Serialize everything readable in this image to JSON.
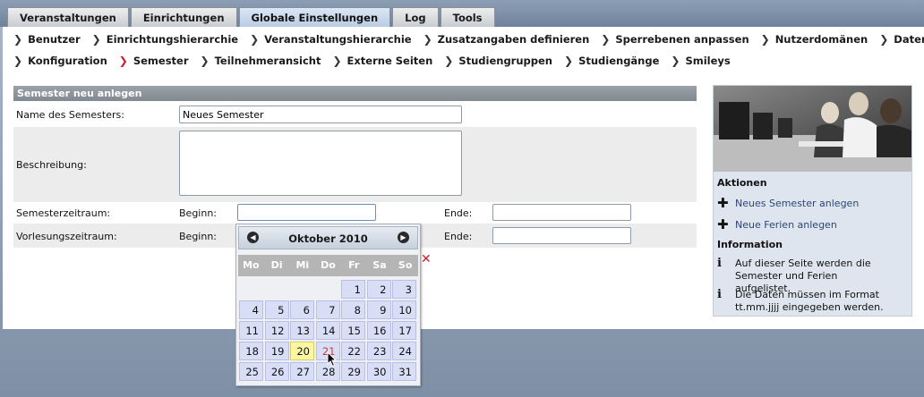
{
  "tabs": [
    "Veranstaltungen",
    "Einrichtungen",
    "Globale Einstellungen",
    "Log",
    "Tools"
  ],
  "active_tab": "Globale Einstellungen",
  "subnav_row1": [
    "Benutzer",
    "Einrichtungshierarchie",
    "Veranstaltungshierarchie",
    "Zusatzangaben definieren",
    "Sperrebenen anpassen",
    "Nutzerdomänen",
    "Datenfelder"
  ],
  "subnav_row2": [
    "Konfiguration",
    "Semester",
    "Teilnehmeransicht",
    "Externe Seiten",
    "Studiengruppen",
    "Studiengänge",
    "Smileys"
  ],
  "active_subnav": "Semester",
  "form": {
    "header": "Semester neu anlegen",
    "name_label": "Name des Semesters:",
    "name_value": "Neues Semester",
    "description_label": "Beschreibung:",
    "description_value": "",
    "semester_period_label": "Semesterzeitraum:",
    "lecture_period_label": "Vorlesungszeitraum:",
    "begin_label": "Beginn:",
    "end_label": "Ende:"
  },
  "calendar": {
    "title": "Oktober 2010",
    "weekdays": [
      "Mo",
      "Di",
      "Mi",
      "Do",
      "Fr",
      "Sa",
      "So"
    ],
    "leading_blanks": 4,
    "days": [
      "1",
      "2",
      "3",
      "4",
      "5",
      "6",
      "7",
      "8",
      "9",
      "10",
      "11",
      "12",
      "13",
      "14",
      "15",
      "16",
      "17",
      "18",
      "19",
      "20",
      "21",
      "22",
      "23",
      "24",
      "25",
      "26",
      "27",
      "28",
      "29",
      "30",
      "31"
    ],
    "today": "20",
    "highlighted_red": "21"
  },
  "sidebar": {
    "actions_title": "Aktionen",
    "actions": [
      "Neues Semester anlegen",
      "Neue Ferien anlegen"
    ],
    "info_title": "Information",
    "info": [
      "Auf dieser Seite werden die Semester und Ferien aufgelistet.",
      "Die Daten müssen im Format tt.mm.jjjj eingegeben werden."
    ]
  },
  "colors": {
    "accent_red": "#c8202c",
    "link_blue": "#2b4774",
    "today_yellow": "#fdf7a2"
  }
}
